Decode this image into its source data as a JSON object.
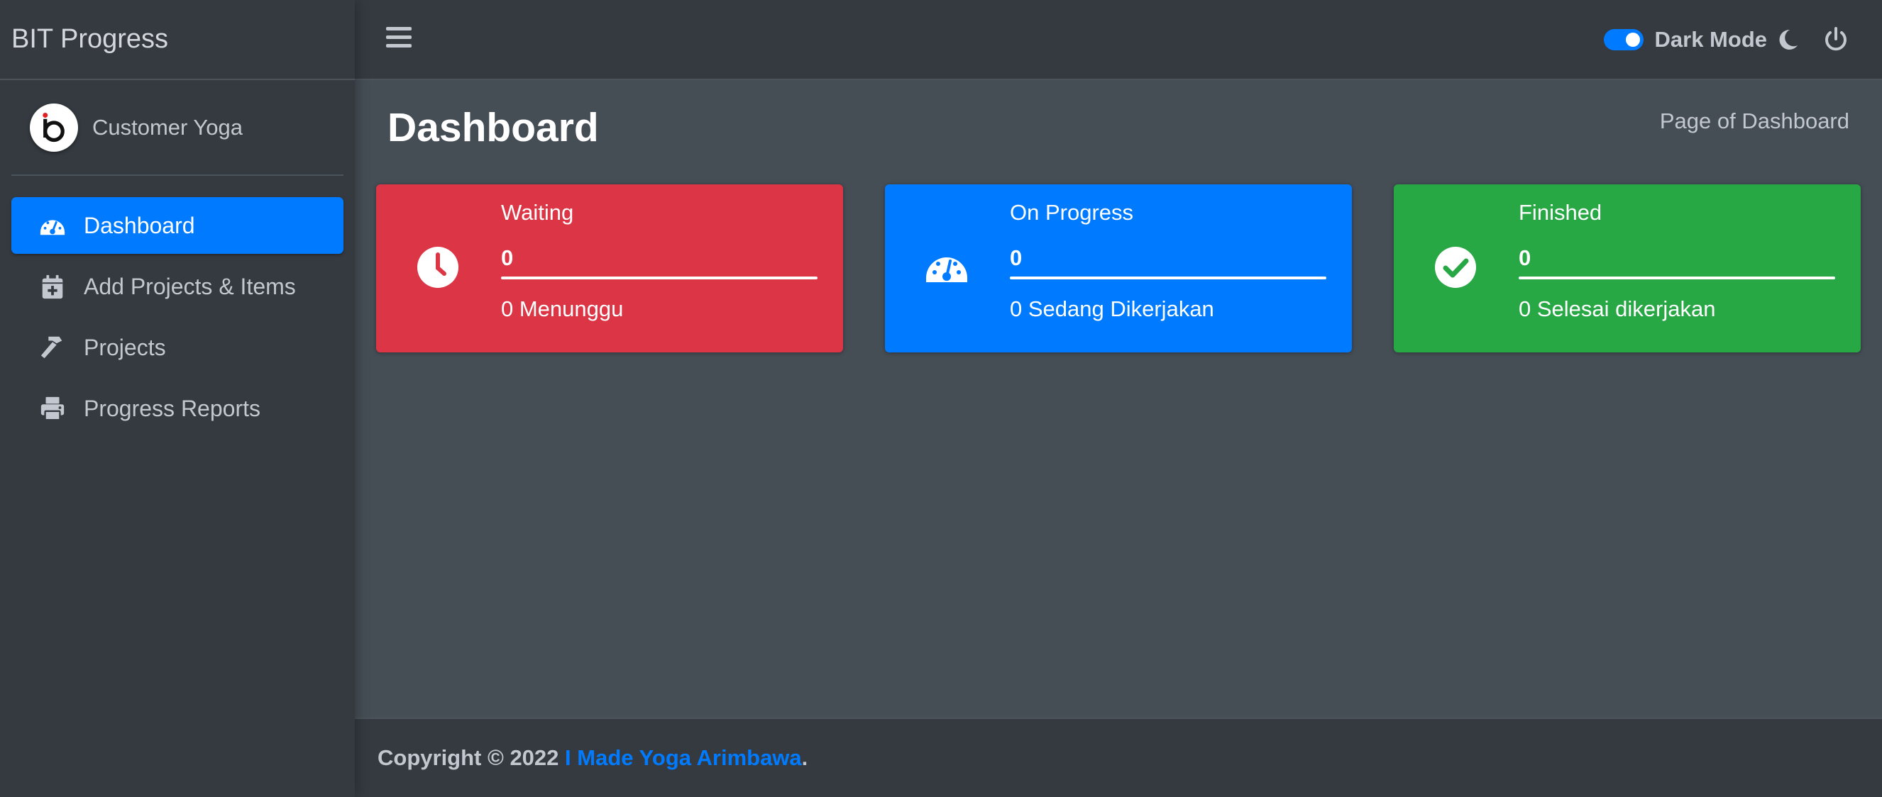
{
  "brand": {
    "title": "BIT Progress"
  },
  "user": {
    "name": "Customer Yoga"
  },
  "sidebar": {
    "items": [
      {
        "label": "Dashboard",
        "icon": "tachometer-icon",
        "active": true
      },
      {
        "label": "Add Projects & Items",
        "icon": "calendar-plus-icon",
        "active": false
      },
      {
        "label": "Projects",
        "icon": "hammer-icon",
        "active": false
      },
      {
        "label": "Progress Reports",
        "icon": "printer-icon",
        "active": false
      }
    ]
  },
  "topbar": {
    "dark_mode_label": "Dark Mode",
    "dark_mode_on": true
  },
  "page": {
    "title": "Dashboard",
    "breadcrumb": "Page of Dashboard"
  },
  "cards": [
    {
      "label": "Waiting",
      "value": "0",
      "desc": "0 Menunggu",
      "color": "#dc3545",
      "icon": "clock-icon"
    },
    {
      "label": "On Progress",
      "value": "0",
      "desc": "0 Sedang Dikerjakan",
      "color": "#007bff",
      "icon": "gauge-icon"
    },
    {
      "label": "Finished",
      "value": "0",
      "desc": "0 Selesai dikerjakan",
      "color": "#28a745",
      "icon": "check-circle-icon"
    }
  ],
  "footer": {
    "prefix": "Copyright © 2022 ",
    "author": "I Made Yoga Arimbawa",
    "suffix": "."
  },
  "colors": {
    "accent": "#007bff",
    "sidebar_bg": "#343a40",
    "content_bg": "#454d55"
  }
}
